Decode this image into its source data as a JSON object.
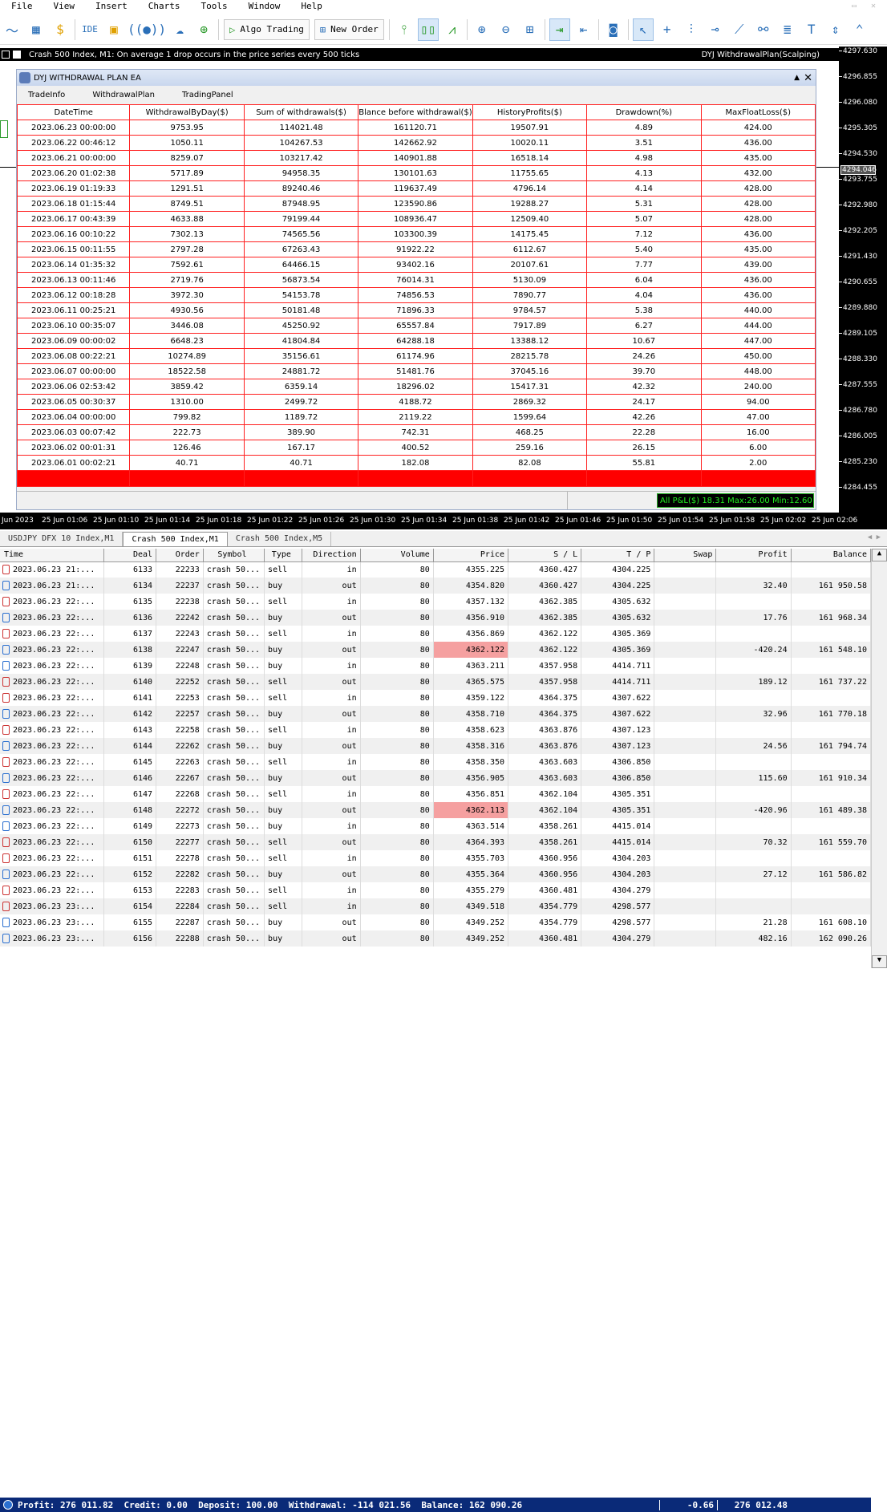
{
  "menu": [
    "File",
    "View",
    "Insert",
    "Charts",
    "Tools",
    "Window",
    "Help"
  ],
  "toolbar": {
    "ide": "IDE",
    "algo_trading": "Algo Trading",
    "new_order": "New Order"
  },
  "chart": {
    "info_left": "Crash 500 Index, M1:  On average 1 drop occurs in the price series every 500 ticks",
    "info_right": "DYJ WithdrawalPlan(Scalping)",
    "price_ticks": [
      "4297.630",
      "4296.855",
      "4296.080",
      "4295.305",
      "4294.530",
      "4293.755",
      "4292.980",
      "4292.205",
      "4291.430",
      "4290.655",
      "4289.880",
      "4289.105",
      "4288.330",
      "4287.555",
      "4286.780",
      "4286.005",
      "4285.230",
      "4284.455"
    ],
    "current_price": "4294.046",
    "time_ticks": [
      "Jun 2023",
      "25 Jun 01:06",
      "25 Jun 01:10",
      "25 Jun 01:14",
      "25 Jun 01:18",
      "25 Jun 01:22",
      "25 Jun 01:26",
      "25 Jun 01:30",
      "25 Jun 01:34",
      "25 Jun 01:38",
      "25 Jun 01:42",
      "25 Jun 01:46",
      "25 Jun 01:50",
      "25 Jun 01:54",
      "25 Jun 01:58",
      "25 Jun 02:02",
      "25 Jun 02:06"
    ]
  },
  "ea": {
    "title": "DYJ WITHDRAWAL PLAN EA",
    "tabs": [
      "TradeInfo",
      "WithdrawalPlan",
      "TradingPanel"
    ],
    "headers": [
      "DateTime",
      "WithdrawalByDay($)",
      "Sum of withdrawals($)",
      "Blance before withdrawal($)",
      "HistoryProfits($)",
      "Drawdown(%)",
      "MaxFloatLoss($)"
    ],
    "rows": [
      [
        "2023.06.23 00:00:00",
        "9753.95",
        "114021.48",
        "161120.71",
        "19507.91",
        "4.89",
        "424.00"
      ],
      [
        "2023.06.22 00:46:12",
        "1050.11",
        "104267.53",
        "142662.92",
        "10020.11",
        "3.51",
        "436.00"
      ],
      [
        "2023.06.21 00:00:00",
        "8259.07",
        "103217.42",
        "140901.88",
        "16518.14",
        "4.98",
        "435.00"
      ],
      [
        "2023.06.20 01:02:38",
        "5717.89",
        "94958.35",
        "130101.63",
        "11755.65",
        "4.13",
        "432.00"
      ],
      [
        "2023.06.19 01:19:33",
        "1291.51",
        "89240.46",
        "119637.49",
        "4796.14",
        "4.14",
        "428.00"
      ],
      [
        "2023.06.18 01:15:44",
        "8749.51",
        "87948.95",
        "123590.86",
        "19288.27",
        "5.31",
        "428.00"
      ],
      [
        "2023.06.17 00:43:39",
        "4633.88",
        "79199.44",
        "108936.47",
        "12509.40",
        "5.07",
        "428.00"
      ],
      [
        "2023.06.16 00:10:22",
        "7302.13",
        "74565.56",
        "103300.39",
        "14175.45",
        "7.12",
        "436.00"
      ],
      [
        "2023.06.15 00:11:55",
        "2797.28",
        "67263.43",
        "91922.22",
        "6112.67",
        "5.40",
        "435.00"
      ],
      [
        "2023.06.14 01:35:32",
        "7592.61",
        "64466.15",
        "93402.16",
        "20107.61",
        "7.77",
        "439.00"
      ],
      [
        "2023.06.13 00:11:46",
        "2719.76",
        "56873.54",
        "76014.31",
        "5130.09",
        "6.04",
        "436.00"
      ],
      [
        "2023.06.12 00:18:28",
        "3972.30",
        "54153.78",
        "74856.53",
        "7890.77",
        "4.04",
        "436.00"
      ],
      [
        "2023.06.11 00:25:21",
        "4930.56",
        "50181.48",
        "71896.33",
        "9784.57",
        "5.38",
        "440.00"
      ],
      [
        "2023.06.10 00:35:07",
        "3446.08",
        "45250.92",
        "65557.84",
        "7917.89",
        "6.27",
        "444.00"
      ],
      [
        "2023.06.09 00:00:02",
        "6648.23",
        "41804.84",
        "64288.18",
        "13388.12",
        "10.67",
        "447.00"
      ],
      [
        "2023.06.08 00:22:21",
        "10274.89",
        "35156.61",
        "61174.96",
        "28215.78",
        "24.26",
        "450.00"
      ],
      [
        "2023.06.07 00:00:00",
        "18522.58",
        "24881.72",
        "51481.76",
        "37045.16",
        "39.70",
        "448.00"
      ],
      [
        "2023.06.06 02:53:42",
        "3859.42",
        "6359.14",
        "18296.02",
        "15417.31",
        "42.32",
        "240.00"
      ],
      [
        "2023.06.05 00:30:37",
        "1310.00",
        "2499.72",
        "4188.72",
        "2869.32",
        "24.17",
        "94.00"
      ],
      [
        "2023.06.04 00:00:00",
        "799.82",
        "1189.72",
        "2119.22",
        "1599.64",
        "42.26",
        "47.00"
      ],
      [
        "2023.06.03 00:07:42",
        "222.73",
        "389.90",
        "742.31",
        "468.25",
        "22.28",
        "16.00"
      ],
      [
        "2023.06.02 00:01:31",
        "126.46",
        "167.17",
        "400.52",
        "259.16",
        "26.15",
        "6.00"
      ],
      [
        "2023.06.01 00:02:21",
        "40.71",
        "40.71",
        "182.08",
        "82.08",
        "55.81",
        "2.00"
      ]
    ],
    "status_pl": "All P&L($) 18.31 Max:26.00 Min:12.60"
  },
  "chart_tabs": [
    "USDJPY DFX 10 Index,M1",
    "Crash 500 Index,M1",
    "Crash 500 Index,M5"
  ],
  "history": {
    "headers": [
      "Time",
      "Deal",
      "Order",
      "Symbol",
      "Type",
      "Direction",
      "Volume",
      "Price",
      "S / L",
      "T / P",
      "Swap",
      "Profit",
      "Balance"
    ],
    "rows": [
      [
        "2023.06.23 21:...",
        "6133",
        "22233",
        "crash 50...",
        "sell",
        "in",
        "80",
        "4355.225",
        "4360.427",
        "4304.225",
        "",
        "",
        ""
      ],
      [
        "2023.06.23 21:...",
        "6134",
        "22237",
        "crash 50...",
        "buy",
        "out",
        "80",
        "4354.820",
        "4360.427",
        "4304.225",
        "",
        "32.40",
        "161 950.58"
      ],
      [
        "2023.06.23 22:...",
        "6135",
        "22238",
        "crash 50...",
        "sell",
        "in",
        "80",
        "4357.132",
        "4362.385",
        "4305.632",
        "",
        "",
        ""
      ],
      [
        "2023.06.23 22:...",
        "6136",
        "22242",
        "crash 50...",
        "buy",
        "out",
        "80",
        "4356.910",
        "4362.385",
        "4305.632",
        "",
        "17.76",
        "161 968.34"
      ],
      [
        "2023.06.23 22:...",
        "6137",
        "22243",
        "crash 50...",
        "sell",
        "in",
        "80",
        "4356.869",
        "4362.122",
        "4305.369",
        "",
        "",
        ""
      ],
      [
        "2023.06.23 22:...",
        "6138",
        "22247",
        "crash 50...",
        "buy",
        "out",
        "80",
        "4362.122",
        "4362.122",
        "4305.369",
        "",
        "-420.24",
        "161 548.10"
      ],
      [
        "2023.06.23 22:...",
        "6139",
        "22248",
        "crash 50...",
        "buy",
        "in",
        "80",
        "4363.211",
        "4357.958",
        "4414.711",
        "",
        "",
        ""
      ],
      [
        "2023.06.23 22:...",
        "6140",
        "22252",
        "crash 50...",
        "sell",
        "out",
        "80",
        "4365.575",
        "4357.958",
        "4414.711",
        "",
        "189.12",
        "161 737.22"
      ],
      [
        "2023.06.23 22:...",
        "6141",
        "22253",
        "crash 50...",
        "sell",
        "in",
        "80",
        "4359.122",
        "4364.375",
        "4307.622",
        "",
        "",
        ""
      ],
      [
        "2023.06.23 22:...",
        "6142",
        "22257",
        "crash 50...",
        "buy",
        "out",
        "80",
        "4358.710",
        "4364.375",
        "4307.622",
        "",
        "32.96",
        "161 770.18"
      ],
      [
        "2023.06.23 22:...",
        "6143",
        "22258",
        "crash 50...",
        "sell",
        "in",
        "80",
        "4358.623",
        "4363.876",
        "4307.123",
        "",
        "",
        ""
      ],
      [
        "2023.06.23 22:...",
        "6144",
        "22262",
        "crash 50...",
        "buy",
        "out",
        "80",
        "4358.316",
        "4363.876",
        "4307.123",
        "",
        "24.56",
        "161 794.74"
      ],
      [
        "2023.06.23 22:...",
        "6145",
        "22263",
        "crash 50...",
        "sell",
        "in",
        "80",
        "4358.350",
        "4363.603",
        "4306.850",
        "",
        "",
        ""
      ],
      [
        "2023.06.23 22:...",
        "6146",
        "22267",
        "crash 50...",
        "buy",
        "out",
        "80",
        "4356.905",
        "4363.603",
        "4306.850",
        "",
        "115.60",
        "161 910.34"
      ],
      [
        "2023.06.23 22:...",
        "6147",
        "22268",
        "crash 50...",
        "sell",
        "in",
        "80",
        "4356.851",
        "4362.104",
        "4305.351",
        "",
        "",
        ""
      ],
      [
        "2023.06.23 22:...",
        "6148",
        "22272",
        "crash 50...",
        "buy",
        "out",
        "80",
        "4362.113",
        "4362.104",
        "4305.351",
        "",
        "-420.96",
        "161 489.38"
      ],
      [
        "2023.06.23 22:...",
        "6149",
        "22273",
        "crash 50...",
        "buy",
        "in",
        "80",
        "4363.514",
        "4358.261",
        "4415.014",
        "",
        "",
        ""
      ],
      [
        "2023.06.23 22:...",
        "6150",
        "22277",
        "crash 50...",
        "sell",
        "out",
        "80",
        "4364.393",
        "4358.261",
        "4415.014",
        "",
        "70.32",
        "161 559.70"
      ],
      [
        "2023.06.23 22:...",
        "6151",
        "22278",
        "crash 50...",
        "sell",
        "in",
        "80",
        "4355.703",
        "4360.956",
        "4304.203",
        "",
        "",
        ""
      ],
      [
        "2023.06.23 22:...",
        "6152",
        "22282",
        "crash 50...",
        "buy",
        "out",
        "80",
        "4355.364",
        "4360.956",
        "4304.203",
        "",
        "27.12",
        "161 586.82"
      ],
      [
        "2023.06.23 22:...",
        "6153",
        "22283",
        "crash 50...",
        "sell",
        "in",
        "80",
        "4355.279",
        "4360.481",
        "4304.279",
        "",
        "",
        ""
      ],
      [
        "2023.06.23 23:...",
        "6154",
        "22284",
        "crash 50...",
        "sell",
        "in",
        "80",
        "4349.518",
        "4354.779",
        "4298.577",
        "",
        "",
        ""
      ],
      [
        "2023.06.23 23:...",
        "6155",
        "22287",
        "crash 50...",
        "buy",
        "out",
        "80",
        "4349.252",
        "4354.779",
        "4298.577",
        "",
        "21.28",
        "161 608.10"
      ],
      [
        "2023.06.23 23:...",
        "6156",
        "22288",
        "crash 50...",
        "buy",
        "out",
        "80",
        "4349.252",
        "4360.481",
        "4304.279",
        "",
        "482.16",
        "162 090.26"
      ]
    ],
    "highlight_rows": [
      5,
      15
    ],
    "summary": "Profit: 276 011.82  Credit: 0.00  Deposit: 100.00  Withdrawal: -114 021.56  Balance: 162 090.26",
    "summary_swap": "-0.66",
    "summary_profit": "276 012.48"
  },
  "colors": {
    "accent_red": "#ff0000",
    "pl_green": "#22ee22",
    "summary_blue": "#0a2a78"
  }
}
